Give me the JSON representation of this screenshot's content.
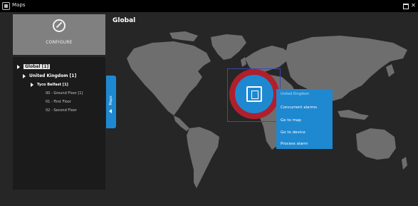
{
  "window": {
    "title": "Maps"
  },
  "configure": {
    "label": "CONFIGURE"
  },
  "tree": [
    {
      "label": "Global [1]",
      "level": 0,
      "selected": true
    },
    {
      "label": "United Kingdom [1]",
      "level": 1
    },
    {
      "label": "Tyco Belfast [1]",
      "level": 2
    },
    {
      "label": "00 - Ground Floor [1]",
      "level": 3
    },
    {
      "label": "01 - First Floor",
      "level": 3
    },
    {
      "label": "02 - Second Floor",
      "level": 3
    }
  ],
  "maps_tab": {
    "label": "Maps"
  },
  "map": {
    "title": "Global"
  },
  "context_menu": {
    "header": "United Kingdom",
    "items": [
      "Concurrent alarms",
      "Go to map",
      "Go to device",
      "Process alarm"
    ]
  },
  "colors": {
    "accent": "#1e88d1",
    "alarm": "#b01f2c",
    "land": "#6e6e6e"
  }
}
